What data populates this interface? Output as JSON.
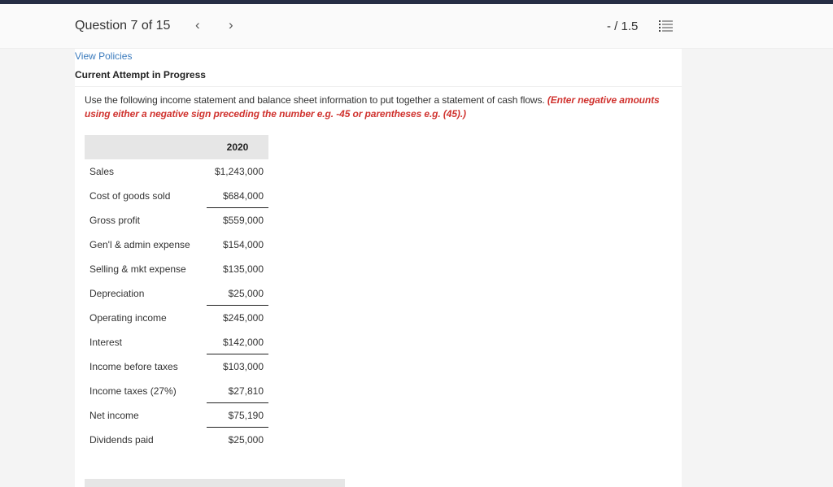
{
  "header": {
    "question_label": "Question 7 of 15",
    "prev_icon": "‹",
    "next_icon": "›",
    "score": "- / 1.5",
    "list_icon": "list-icon"
  },
  "links": {
    "view_policies": "View Policies"
  },
  "status": {
    "attempt": "Current Attempt in Progress"
  },
  "instructions": {
    "text": "Use the following income statement and balance sheet information to put together a statement of cash flows. ",
    "emphasis": "(Enter negative amounts using either a negative sign preceding the number e.g. -45 or parentheses e.g. (45).)"
  },
  "table": {
    "year": "2020",
    "rows": [
      {
        "label": "Sales",
        "value": "$1,243,000"
      },
      {
        "label": "Cost of goods sold",
        "value": "$684,000"
      },
      {
        "label": "Gross profit",
        "value": "$559,000"
      },
      {
        "label": "Gen'l & admin expense",
        "value": "$154,000"
      },
      {
        "label": "Selling & mkt expense",
        "value": "$135,000"
      },
      {
        "label": "Depreciation",
        "value": "$25,000"
      },
      {
        "label": "Operating income",
        "value": "$245,000"
      },
      {
        "label": "Interest",
        "value": "$142,000"
      },
      {
        "label": "Income before taxes",
        "value": "$103,000"
      },
      {
        "label": "Income taxes (27%)",
        "value": "$27,810"
      },
      {
        "label": "Net income",
        "value": "$75,190"
      },
      {
        "label": "Dividends paid",
        "value": "$25,000"
      }
    ]
  },
  "colors": {
    "accent_dark": "#262d44",
    "link": "#3b7bbd",
    "emphasis": "#d0332f"
  }
}
